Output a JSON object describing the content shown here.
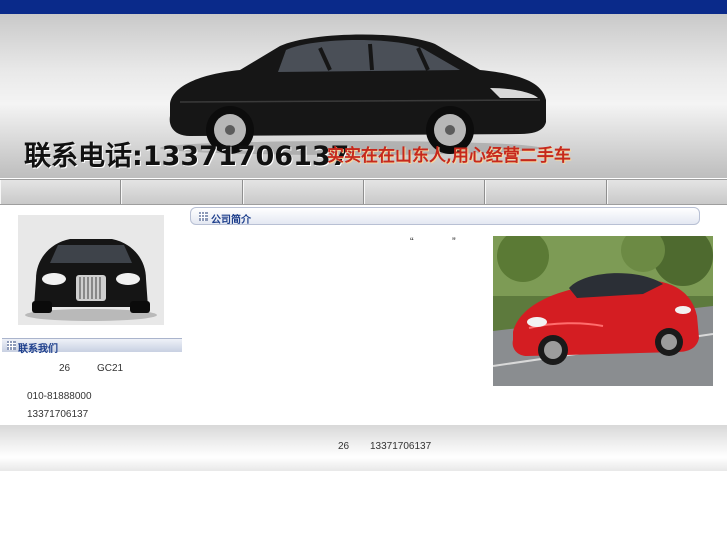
{
  "banner": {
    "phone_text": "联系电话:13371706137",
    "slogan_text": "实实在在山东人,用心经营二手车"
  },
  "nav": {
    "items": [
      "",
      "",
      "",
      "",
      "",
      ""
    ]
  },
  "sidebar": {
    "contact_title": "联系我们",
    "address_num": "26",
    "address_code": "GC21",
    "phone_landline": "010-81888000",
    "phone_mobile": "13371706137"
  },
  "main": {
    "about_title": "公司简介",
    "quote_open": "“",
    "quote_close": "”"
  },
  "footer": {
    "address_num": "26",
    "phone": "13371706137"
  },
  "colors": {
    "top_strip": "#0a2a8a",
    "section_title": "#1e3f8c",
    "slogan": "#c6281c"
  }
}
